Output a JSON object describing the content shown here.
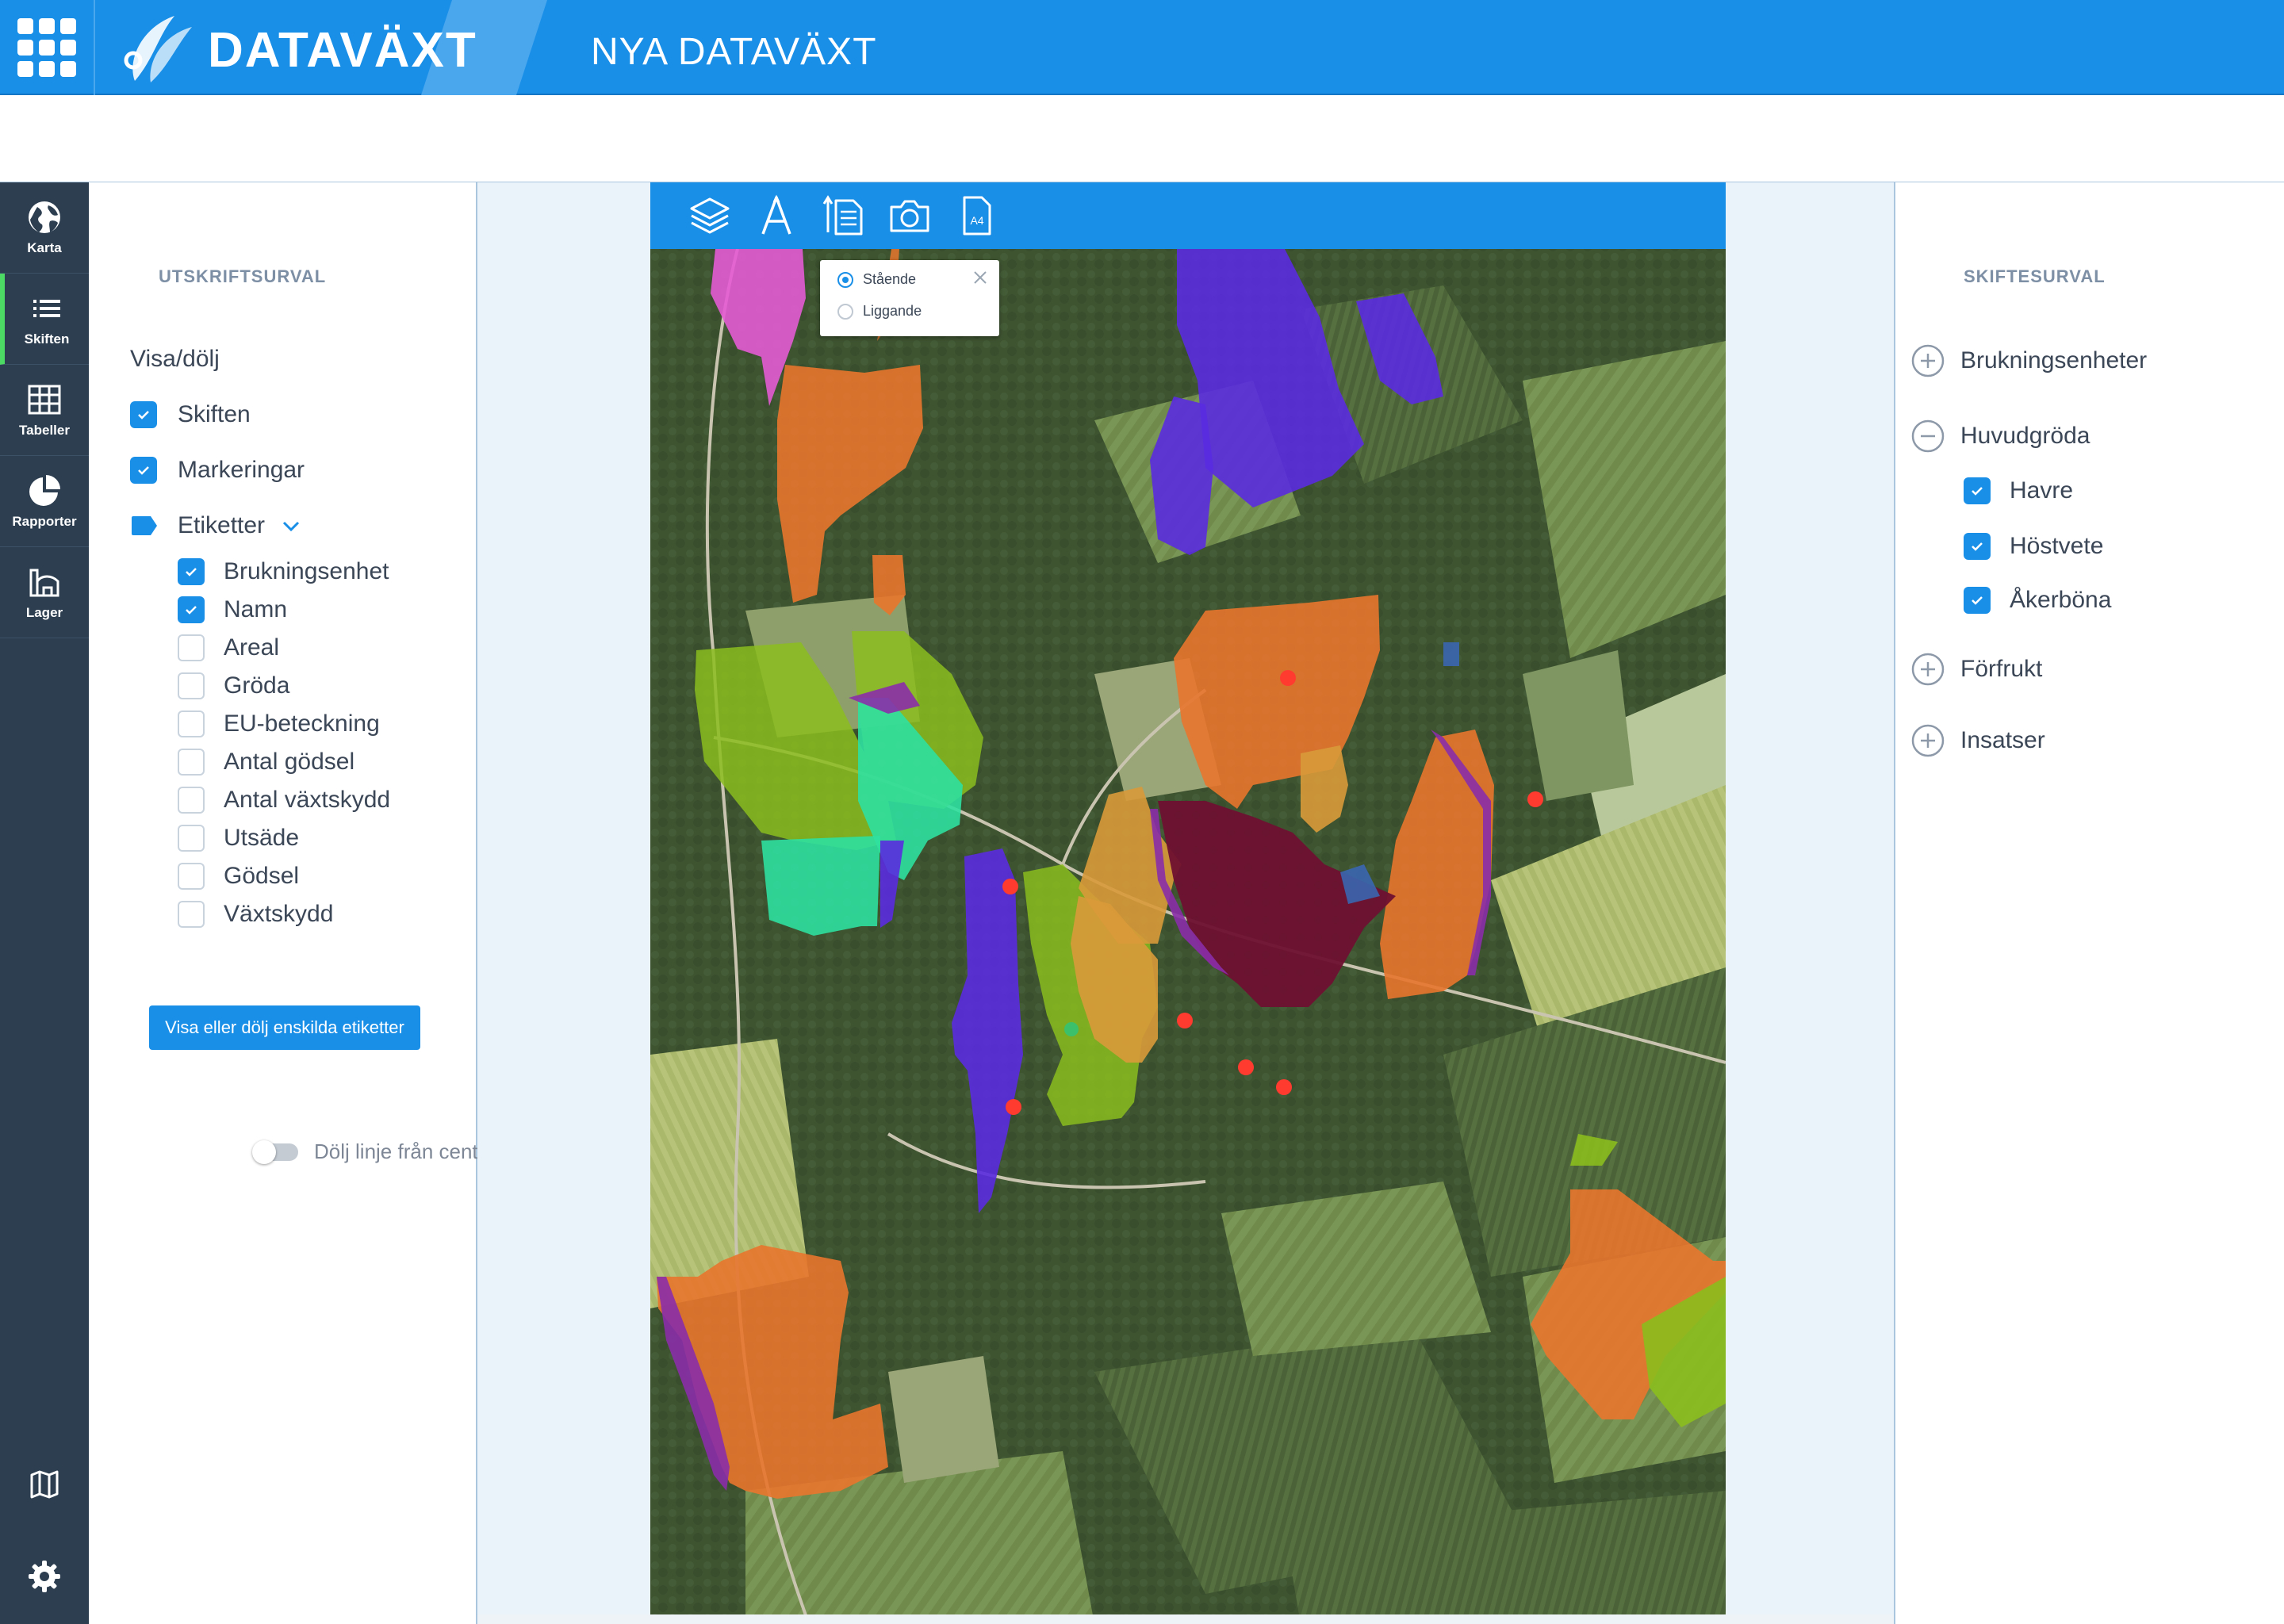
{
  "header": {
    "logo_text": "DATAVÄXT",
    "app_title": "NYA DATAVÄXT"
  },
  "nav": {
    "items": [
      {
        "label": "Karta",
        "icon": "globe-icon"
      },
      {
        "label": "Skiften",
        "icon": "list-icon",
        "active": true
      },
      {
        "label": "Tabeller",
        "icon": "table-icon"
      },
      {
        "label": "Rapporter",
        "icon": "pie-chart-icon"
      },
      {
        "label": "Lager",
        "icon": "warehouse-icon"
      }
    ],
    "bottom_icons": [
      "map-icon",
      "gear-icon"
    ]
  },
  "left_panel": {
    "title": "UTSKRIFTSURVAL",
    "section": "Visa/dölj",
    "top_checks": [
      {
        "label": "Skiften",
        "checked": true
      },
      {
        "label": "Markeringar",
        "checked": true
      }
    ],
    "labels_group": {
      "label": "Etiketter",
      "icon": "tag-icon"
    },
    "label_checks": [
      {
        "label": "Brukningsenhet",
        "checked": true
      },
      {
        "label": "Namn",
        "checked": true
      },
      {
        "label": "Areal",
        "checked": false
      },
      {
        "label": "Gröda",
        "checked": false
      },
      {
        "label": "EU-beteckning",
        "checked": false
      },
      {
        "label": "Antal gödsel",
        "checked": false
      },
      {
        "label": "Antal växtskydd",
        "checked": false
      },
      {
        "label": "Utsäde",
        "checked": false
      },
      {
        "label": "Gödsel",
        "checked": false
      },
      {
        "label": "Växtskydd",
        "checked": false
      }
    ],
    "toggle_label": "Dölj linje från centrum",
    "button_label": "Visa eller dölj enskilda etiketter"
  },
  "right_panel": {
    "title": "SKIFTESURVAL",
    "groups": [
      {
        "label": "Brukningsenheter",
        "expanded": false
      },
      {
        "label": "Huvudgröda",
        "expanded": true
      },
      {
        "label": "Förfrukt",
        "expanded": false
      },
      {
        "label": "Insatser",
        "expanded": false
      }
    ],
    "crops": [
      {
        "label": "Havre",
        "checked": true
      },
      {
        "label": "Höstvete",
        "checked": true
      },
      {
        "label": "Åkerböna",
        "checked": true
      }
    ]
  },
  "map": {
    "toolbar": [
      "layers-icon",
      "text-icon",
      "orientation-icon",
      "camera-icon",
      "paper-size-icon"
    ],
    "paper_size_label": "A4",
    "orientation": {
      "options": [
        {
          "label": "Stående",
          "selected": true
        },
        {
          "label": "Liggande",
          "selected": false
        }
      ]
    },
    "colors": {
      "orange": "#e8762e",
      "purple": "#5a2be0",
      "magenta": "#e45bd4",
      "lime": "#8bbd1e",
      "teal": "#2fe0a0",
      "maroon": "#6e1030",
      "ochre": "#d99a3a",
      "marker": "#ff3b30"
    }
  }
}
